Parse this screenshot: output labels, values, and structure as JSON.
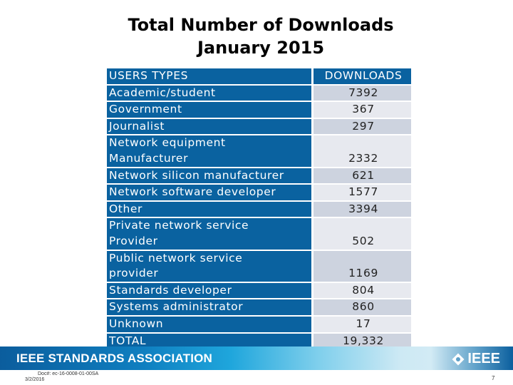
{
  "title": {
    "line1": "Total Number of Downloads",
    "line2": "January 2015"
  },
  "table": {
    "headers": [
      "USERS TYPES",
      "DOWNLOADS"
    ],
    "rows": [
      {
        "label_lines": [
          "Academic/student"
        ],
        "value": "7392"
      },
      {
        "label_lines": [
          "Government"
        ],
        "value": "367"
      },
      {
        "label_lines": [
          "Journalist"
        ],
        "value": "297"
      },
      {
        "label_lines": [
          "Network equipment",
          "Manufacturer"
        ],
        "value": "2332"
      },
      {
        "label_lines": [
          "Network silicon manufacturer"
        ],
        "value": "621"
      },
      {
        "label_lines": [
          "Network software developer"
        ],
        "value": "1577"
      },
      {
        "label_lines": [
          "Other"
        ],
        "value": "3394"
      },
      {
        "label_lines": [
          "Private network service",
          "Provider"
        ],
        "value": "502"
      },
      {
        "label_lines": [
          "Public network service",
          "provider"
        ],
        "value": "1169"
      },
      {
        "label_lines": [
          "Standards developer"
        ],
        "value": "804"
      },
      {
        "label_lines": [
          "Systems administrator"
        ],
        "value": "860"
      },
      {
        "label_lines": [
          "Unknown"
        ],
        "value": "17"
      },
      {
        "label_lines": [
          "TOTAL"
        ],
        "value": "19,332"
      }
    ]
  },
  "footer": {
    "banner_text": "IEEE STANDARDS ASSOCIATION",
    "logo_text": "IEEE",
    "doc_number": "Doc#: ec-16-0008-01-00SA",
    "date": "3/2/2016",
    "page_number": "7"
  },
  "colors": {
    "header_blue": "#0a62a0",
    "row_dark": "#cdd3df",
    "row_light": "#e7e9ef"
  }
}
